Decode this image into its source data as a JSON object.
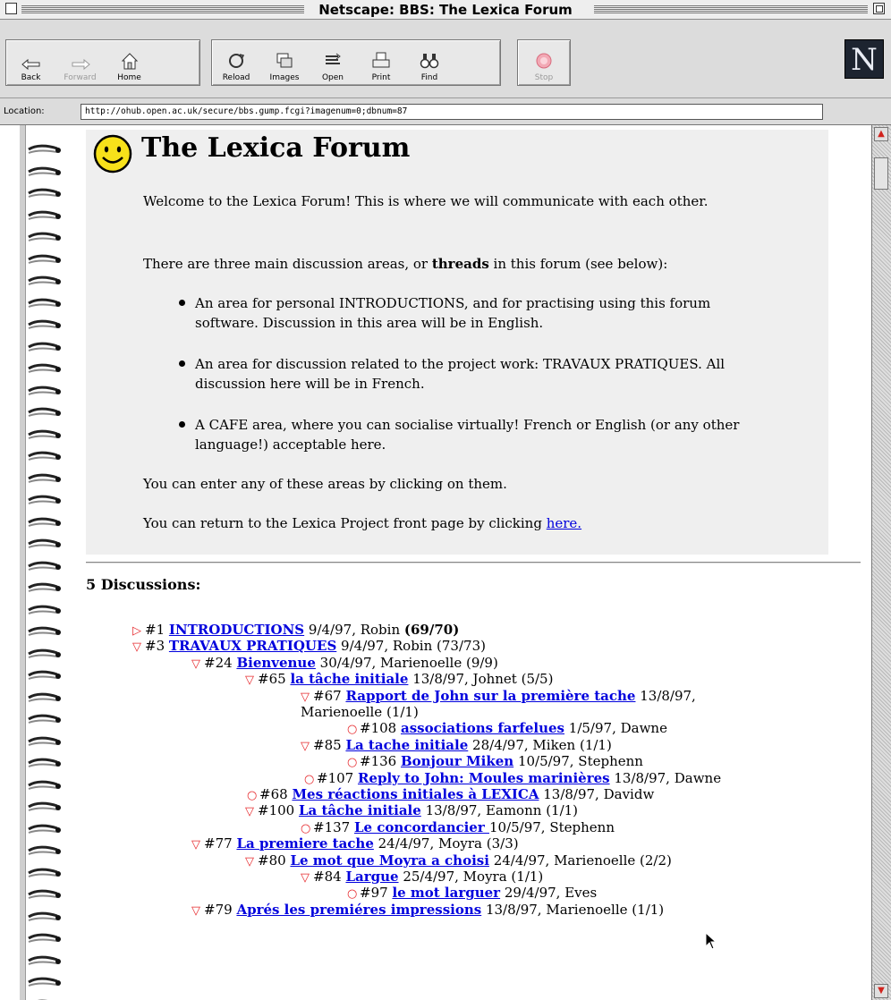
{
  "window": {
    "title": "Netscape: BBS: The Lexica Forum"
  },
  "toolbar": {
    "buttons": [
      {
        "label": "Back",
        "icon": "back-arrow-icon"
      },
      {
        "label": "Forward",
        "icon": "forward-arrow-icon"
      },
      {
        "label": "Home",
        "icon": "home-icon"
      },
      {
        "label": "Reload",
        "icon": "reload-icon"
      },
      {
        "label": "Images",
        "icon": "images-icon"
      },
      {
        "label": "Open",
        "icon": "open-icon"
      },
      {
        "label": "Print",
        "icon": "print-icon"
      },
      {
        "label": "Find",
        "icon": "find-binoculars-icon"
      },
      {
        "label": "Stop",
        "icon": "stop-icon"
      }
    ],
    "logo": "N"
  },
  "location": {
    "label": "Location:",
    "url": "http://ohub.open.ac.uk/secure/bbs.gump.fcgi?imagenum=0;dbnum=87"
  },
  "page": {
    "title": "The Lexica Forum",
    "welcome": "Welcome to the Lexica Forum! This is where we will communicate with each other.",
    "threads_intro_pre": "There are three main discussion areas, or ",
    "threads_bold": "threads",
    "threads_intro_post": " in this forum (see below):",
    "bullets": [
      "An area for personal INTRODUCTIONS, and for practising using this forum software. Discussion in this area will be in English.",
      "An area for discussion related to the project work: TRAVAUX PRATIQUES. All discussion here will be in French.",
      "A CAFE area, where you can socialise virtually! French or English (or any other language!) acceptable here."
    ],
    "enter_text": "You can enter any of these areas by clicking on them.",
    "return_text": "You can return to the Lexica Project front page by clicking ",
    "return_link": "here."
  },
  "discussions": {
    "heading": "5 Discussions:",
    "items": [
      {
        "marker": "▷",
        "num": "#1",
        "title": "INTRODUCTIONS",
        "meta": " 9/4/97, Robin ",
        "count": "(69/70)",
        "count_bold": true
      },
      {
        "marker": "▽",
        "num": "#3",
        "title": "TRAVAUX PRATIQUES",
        "meta": " 9/4/97, Robin ",
        "count": "(73/73)",
        "count_bold": false
      },
      {
        "marker": "▽",
        "num": "#24",
        "title": "Bienvenue",
        "meta": " 30/4/97, Marienoelle ",
        "count": "(9/9)",
        "count_bold": false
      },
      {
        "marker": "▽",
        "num": "#65",
        "title": "la tâche initiale",
        "meta": " 13/8/97, Johnet ",
        "count": "(5/5)",
        "count_bold": false
      },
      {
        "marker": "▽",
        "num": "#67",
        "title": "Rapport de John sur la première tache",
        "meta": " 13/8/97,",
        "count": "",
        "count_bold": false
      },
      {
        "marker": "",
        "num": "",
        "title": "",
        "meta": "Marienoelle ",
        "count": "(1/1)",
        "count_bold": false
      },
      {
        "marker": "○",
        "num": "#108",
        "title": "associations farfelues",
        "meta": " 1/5/97, Dawne",
        "count": "",
        "count_bold": false
      },
      {
        "marker": "▽",
        "num": "#85",
        "title": "La tache initiale",
        "meta": " 28/4/97, Miken ",
        "count": "(1/1)",
        "count_bold": false
      },
      {
        "marker": "○",
        "num": "#136",
        "title": "Bonjour Miken",
        "meta": " 10/5/97, Stephenn",
        "count": "",
        "count_bold": false
      },
      {
        "marker": "○",
        "num": "#107",
        "title": "Reply to John: Moules marinières",
        "meta": " 13/8/97, Dawne",
        "count": "",
        "count_bold": false
      },
      {
        "marker": "○",
        "num": "#68",
        "title": "Mes réactions initiales à LEXICA",
        "meta": " 13/8/97, Davidw",
        "count": "",
        "count_bold": false
      },
      {
        "marker": "▽",
        "num": "#100",
        "title": "La tâche initiale",
        "meta": " 13/8/97, Eamonn ",
        "count": "(1/1)",
        "count_bold": false
      },
      {
        "marker": "○",
        "num": "#137",
        "title": "Le concordancier ",
        "meta": " 10/5/97, Stephenn",
        "count": "",
        "count_bold": false
      },
      {
        "marker": "▽",
        "num": "#77",
        "title": "La premiere tache",
        "meta": " 24/4/97, Moyra ",
        "count": "(3/3)",
        "count_bold": false
      },
      {
        "marker": "▽",
        "num": "#80",
        "title": "Le mot que Moyra a choisi",
        "meta": " 24/4/97, Marienoelle ",
        "count": "(2/2)",
        "count_bold": false
      },
      {
        "marker": "▽",
        "num": "#84",
        "title": "Largue",
        "meta": " 25/4/97, Moyra ",
        "count": "(1/1)",
        "count_bold": false
      },
      {
        "marker": "○",
        "num": "#97",
        "title": "le mot larguer",
        "meta": " 29/4/97, Eves",
        "count": "",
        "count_bold": false
      },
      {
        "marker": "▽",
        "num": "#79",
        "title": "Aprés les premiéres impressions",
        "meta": " 13/8/97, Marienoelle ",
        "count": "(1/1)",
        "count_bold": false
      }
    ]
  },
  "colors": {
    "link": "#0000dd",
    "marker": "#e6272b",
    "intro_bg": "#efefef",
    "smiley": "#f7e11a"
  }
}
